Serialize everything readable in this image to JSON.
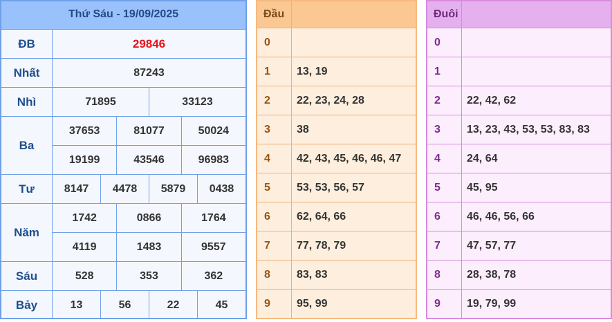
{
  "results": {
    "title": "Thứ Sáu - 19/09/2025",
    "prizes": [
      {
        "label": "ĐB",
        "rows": [
          [
            "29846"
          ]
        ]
      },
      {
        "label": "Nhất",
        "rows": [
          [
            "87243"
          ]
        ]
      },
      {
        "label": "Nhì",
        "rows": [
          [
            "71895",
            "33123"
          ]
        ]
      },
      {
        "label": "Ba",
        "rows": [
          [
            "37653",
            "81077",
            "50024"
          ],
          [
            "19199",
            "43546",
            "96983"
          ]
        ]
      },
      {
        "label": "Tư",
        "rows": [
          [
            "8147",
            "4478",
            "5879",
            "0438"
          ]
        ]
      },
      {
        "label": "Năm",
        "rows": [
          [
            "1742",
            "0866",
            "1764"
          ],
          [
            "4119",
            "1483",
            "9557"
          ]
        ]
      },
      {
        "label": "Sáu",
        "rows": [
          [
            "528",
            "353",
            "362"
          ]
        ]
      },
      {
        "label": "Bảy",
        "rows": [
          [
            "13",
            "56",
            "22",
            "45"
          ]
        ]
      }
    ]
  },
  "dau": {
    "header": "Đầu",
    "rows": [
      {
        "key": "0",
        "value": ""
      },
      {
        "key": "1",
        "value": "13, 19"
      },
      {
        "key": "2",
        "value": "22, 23, 24, 28"
      },
      {
        "key": "3",
        "value": "38"
      },
      {
        "key": "4",
        "value": "42, 43, 45, 46, 46, 47"
      },
      {
        "key": "5",
        "value": "53, 53, 56, 57"
      },
      {
        "key": "6",
        "value": "62, 64, 66"
      },
      {
        "key": "7",
        "value": "77, 78, 79"
      },
      {
        "key": "8",
        "value": "83, 83"
      },
      {
        "key": "9",
        "value": "95, 99"
      }
    ]
  },
  "duoi": {
    "header": "Đuôi",
    "rows": [
      {
        "key": "0",
        "value": ""
      },
      {
        "key": "1",
        "value": ""
      },
      {
        "key": "2",
        "value": "22, 42, 62"
      },
      {
        "key": "3",
        "value": "13, 23, 43, 53, 53, 83, 83"
      },
      {
        "key": "4",
        "value": "24, 64"
      },
      {
        "key": "5",
        "value": "45, 95"
      },
      {
        "key": "6",
        "value": "46, 46, 56, 66"
      },
      {
        "key": "7",
        "value": "47, 57, 77"
      },
      {
        "key": "8",
        "value": "28, 38, 78"
      },
      {
        "key": "9",
        "value": "19, 79, 99"
      }
    ]
  },
  "colors": {
    "results_border": "#6fa0e8",
    "results_header": "#99c1fb",
    "special_prize": "#e8141b",
    "dau_header": "#fbc792",
    "duoi_header": "#e4b0ee"
  }
}
